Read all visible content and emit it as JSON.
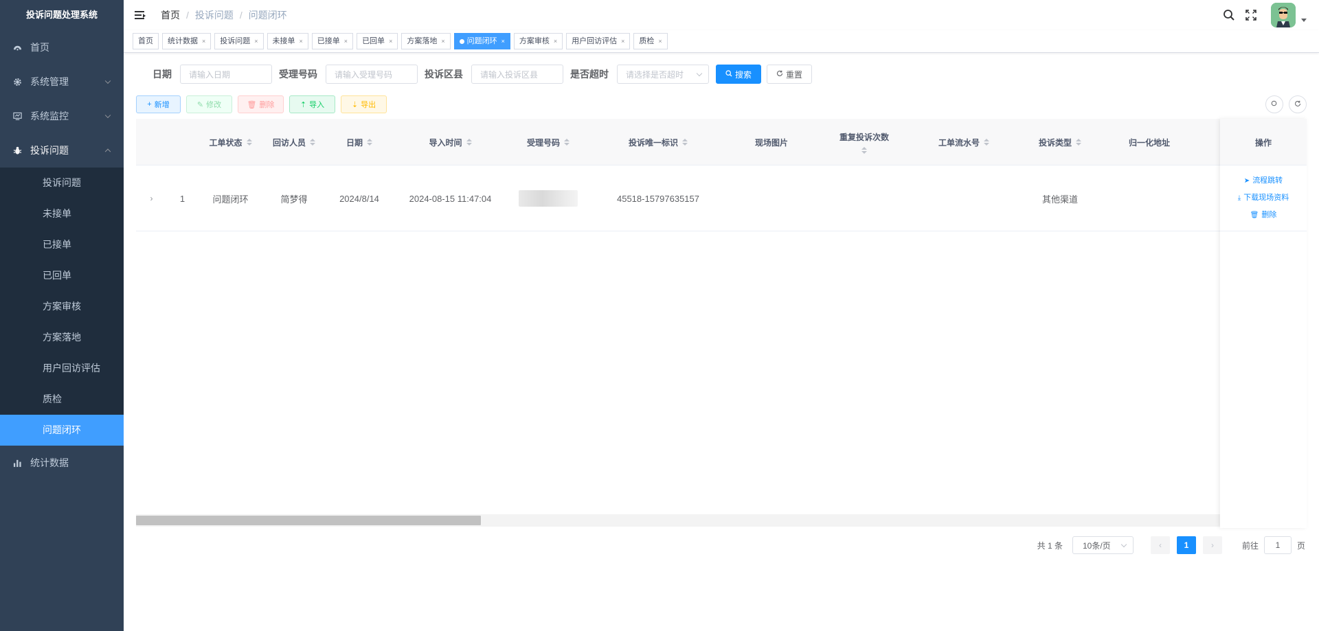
{
  "app": {
    "title": "投诉问题处理系统"
  },
  "sidebar": {
    "items": [
      {
        "label": "首页",
        "icon": "dashboard-icon"
      },
      {
        "label": "系统管理",
        "icon": "gear-icon"
      },
      {
        "label": "系统监控",
        "icon": "monitor-icon"
      },
      {
        "label": "投诉问题",
        "icon": "bug-icon"
      },
      {
        "label": "统计数据",
        "icon": "chart-icon"
      }
    ],
    "submenu": [
      {
        "label": "投诉问题"
      },
      {
        "label": "未接单"
      },
      {
        "label": "已接单"
      },
      {
        "label": "已回单"
      },
      {
        "label": "方案审核"
      },
      {
        "label": "方案落地"
      },
      {
        "label": "用户回访评估"
      },
      {
        "label": "质检"
      },
      {
        "label": "问题闭环",
        "active": true
      }
    ]
  },
  "navbar": {
    "breadcrumb": [
      "首页",
      "投诉问题",
      "问题闭环"
    ],
    "separator": "/"
  },
  "tags": [
    "首页",
    "统计数据",
    "投诉问题",
    "未接单",
    "已接单",
    "已回单",
    "方案落地",
    "问题闭环",
    "方案审核",
    "用户回访评估",
    "质检"
  ],
  "tag_close": "×",
  "search": {
    "fields": [
      {
        "label": "日期",
        "placeholder": "请输入日期"
      },
      {
        "label": "受理号码",
        "placeholder": "请输入受理号码"
      },
      {
        "label": "投诉区县",
        "placeholder": "请输入投诉区县"
      },
      {
        "label": "是否超时",
        "placeholder": "请选择是否超时"
      }
    ],
    "search_label": "搜索",
    "reset_label": "重置"
  },
  "toolbar": {
    "add": "新增",
    "edit": "修改",
    "delete": "删除",
    "import": "导入",
    "export": "导出"
  },
  "table": {
    "columns": [
      "工单状态",
      "回访人员",
      "日期",
      "导入时间",
      "受理号码",
      "投诉唯一标识",
      "现场图片",
      "重复投诉次数",
      "工单流水号",
      "投诉类型",
      "归一化地址",
      "操作"
    ],
    "rows": [
      {
        "index": "1",
        "status": "问题闭环",
        "visitor": "简梦得",
        "date": "2024/8/14",
        "import_time": "2024-08-15 11:47:04",
        "phone": "",
        "unique_id": "45518-15797635157",
        "photo": "",
        "repeat_count": "",
        "serial_no": "",
        "type": "其他渠道",
        "address": ""
      }
    ],
    "actions": [
      "流程跳转",
      "下载现场资料",
      "删除"
    ]
  },
  "pagination": {
    "total": "共 1 条",
    "page_size": "10条/页",
    "current": "1",
    "goto_label": "前往",
    "goto_value": "1",
    "page_suffix": "页"
  },
  "colors": {
    "primary": "#1890ff",
    "sidebar_bg": "#304156",
    "submenu_bg": "#1f2d3d",
    "active_item": "#409eff"
  }
}
